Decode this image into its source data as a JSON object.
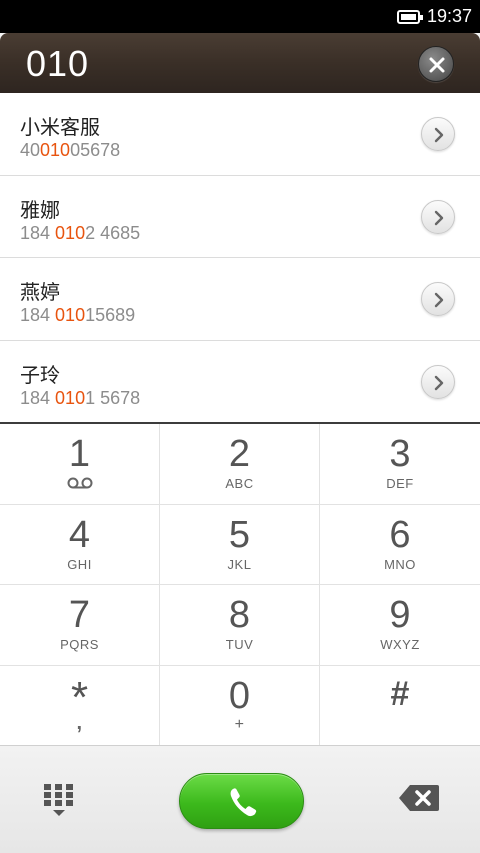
{
  "status_bar": {
    "time": "19:37",
    "battery_icon": "battery-full-icon"
  },
  "header": {
    "dial_input": "010",
    "clear_icon": "clear-circle-icon"
  },
  "contacts": [
    {
      "name": "小米客服",
      "number_pre": "40",
      "number_match": "010",
      "number_post": "05678"
    },
    {
      "name": "雅娜",
      "number_pre": "184 ",
      "number_match": "010",
      "number_post": "2 4685"
    },
    {
      "name": "燕婷",
      "number_pre": "184 ",
      "number_match": "010",
      "number_post": "15689"
    },
    {
      "name": "子玲",
      "number_pre": "184 ",
      "number_match": "010",
      "number_post": "1 5678"
    }
  ],
  "keypad": [
    {
      "digit": "1",
      "letters": ""
    },
    {
      "digit": "2",
      "letters": "ABC"
    },
    {
      "digit": "3",
      "letters": "DEF"
    },
    {
      "digit": "4",
      "letters": "GHI"
    },
    {
      "digit": "5",
      "letters": "JKL"
    },
    {
      "digit": "6",
      "letters": "MNO"
    },
    {
      "digit": "7",
      "letters": "PQRS"
    },
    {
      "digit": "8",
      "letters": "TUV"
    },
    {
      "digit": "9",
      "letters": "WXYZ"
    },
    {
      "digit": "*",
      "letters": ","
    },
    {
      "digit": "0",
      "letters": "+"
    },
    {
      "digit": "#",
      "letters": ""
    }
  ],
  "bottom_bar": {
    "dialpad_icon": "dialpad-grid-icon",
    "call_icon": "phone-handset-icon",
    "backspace_icon": "backspace-icon"
  },
  "colors": {
    "highlight": "#e8540f",
    "call_green": "#3cb91c",
    "header_brown": "#3a2f27"
  }
}
